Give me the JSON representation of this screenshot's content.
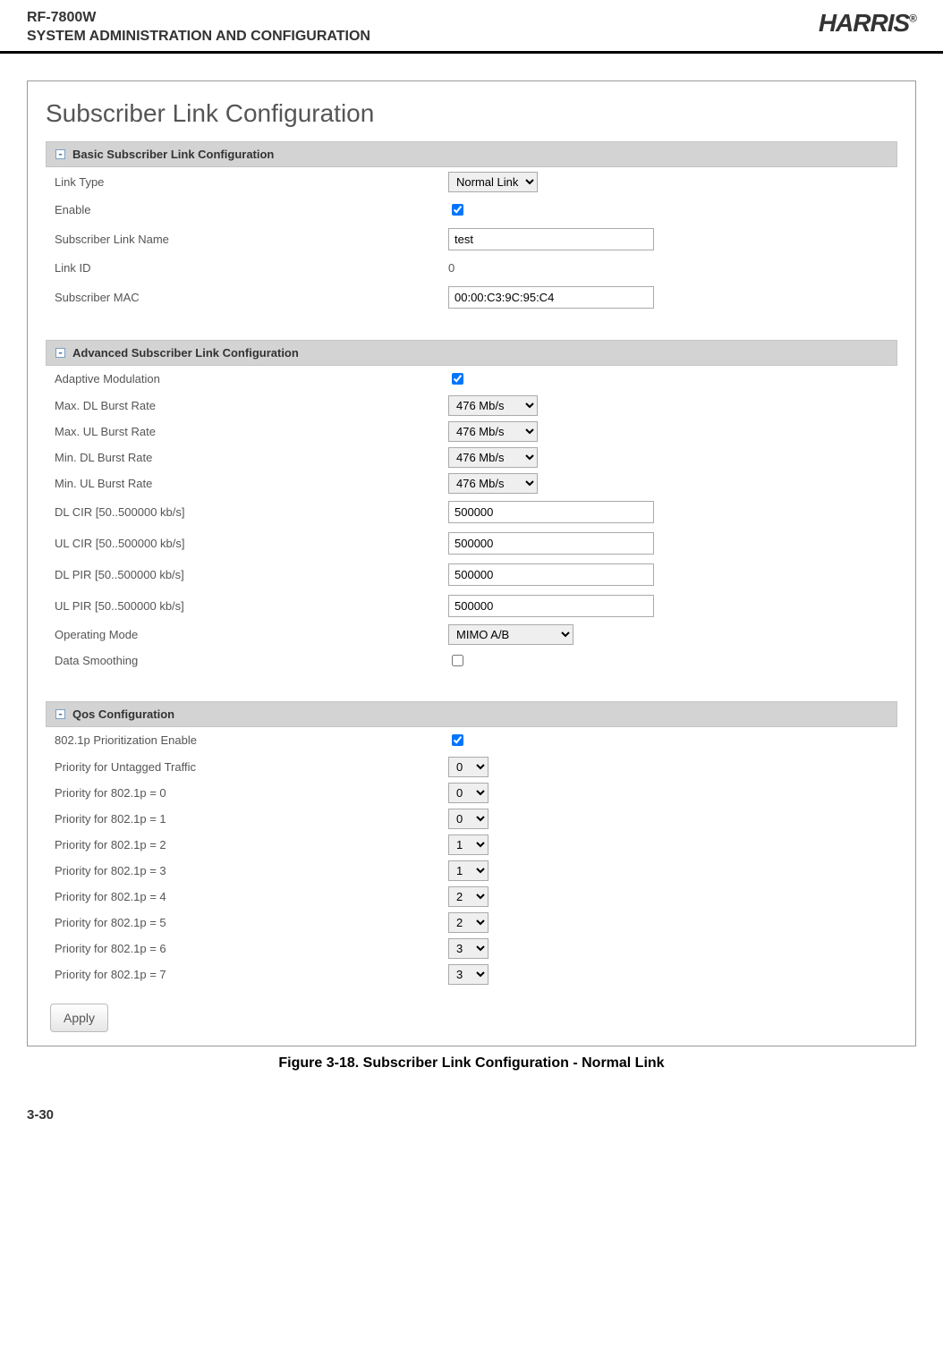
{
  "doc_header": {
    "line1": "RF-7800W",
    "line2": "SYSTEM ADMINISTRATION AND CONFIGURATION",
    "brand": "HARRIS",
    "reg": "®"
  },
  "page_title": "Subscriber Link Configuration",
  "sections": {
    "basic": {
      "title": "Basic Subscriber Link Configuration",
      "fields": {
        "link_type": {
          "label": "Link Type",
          "value": "Normal Link"
        },
        "enable": {
          "label": "Enable",
          "checked": true
        },
        "link_name": {
          "label": "Subscriber Link Name",
          "value": "test"
        },
        "link_id": {
          "label": "Link ID",
          "value": "0"
        },
        "sub_mac": {
          "label": "Subscriber MAC",
          "value": "00:00:C3:9C:95:C4"
        }
      }
    },
    "advanced": {
      "title": "Advanced Subscriber Link Configuration",
      "fields": {
        "adaptive_mod": {
          "label": "Adaptive Modulation",
          "checked": true
        },
        "max_dl": {
          "label": "Max. DL Burst Rate",
          "value": "476 Mb/s"
        },
        "max_ul": {
          "label": "Max. UL Burst Rate",
          "value": "476 Mb/s"
        },
        "min_dl": {
          "label": "Min. DL Burst Rate",
          "value": "476 Mb/s"
        },
        "min_ul": {
          "label": "Min. UL Burst Rate",
          "value": "476 Mb/s"
        },
        "dl_cir": {
          "label": "DL CIR [50..500000 kb/s]",
          "value": "500000"
        },
        "ul_cir": {
          "label": "UL CIR [50..500000 kb/s]",
          "value": "500000"
        },
        "dl_pir": {
          "label": "DL PIR [50..500000 kb/s]",
          "value": "500000"
        },
        "ul_pir": {
          "label": "UL PIR [50..500000 kb/s]",
          "value": "500000"
        },
        "op_mode": {
          "label": "Operating Mode",
          "value": "MIMO A/B"
        },
        "data_smooth": {
          "label": "Data Smoothing",
          "checked": false
        }
      }
    },
    "qos": {
      "title": "Qos Configuration",
      "fields": {
        "prio_enable": {
          "label": "802.1p Prioritization Enable",
          "checked": true
        },
        "untagged": {
          "label": "Priority for Untagged Traffic",
          "value": "0"
        },
        "p0": {
          "label": "Priority for 802.1p = 0",
          "value": "0"
        },
        "p1": {
          "label": "Priority for 802.1p = 1",
          "value": "0"
        },
        "p2": {
          "label": "Priority for 802.1p = 2",
          "value": "1"
        },
        "p3": {
          "label": "Priority for 802.1p = 3",
          "value": "1"
        },
        "p4": {
          "label": "Priority for 802.1p = 4",
          "value": "2"
        },
        "p5": {
          "label": "Priority for 802.1p = 5",
          "value": "2"
        },
        "p6": {
          "label": "Priority for 802.1p = 6",
          "value": "3"
        },
        "p7": {
          "label": "Priority for 802.1p = 7",
          "value": "3"
        }
      }
    }
  },
  "apply_label": "Apply",
  "figure_caption": "Figure 3-18.  Subscriber Link Configuration - Normal Link",
  "page_number": "3-30"
}
